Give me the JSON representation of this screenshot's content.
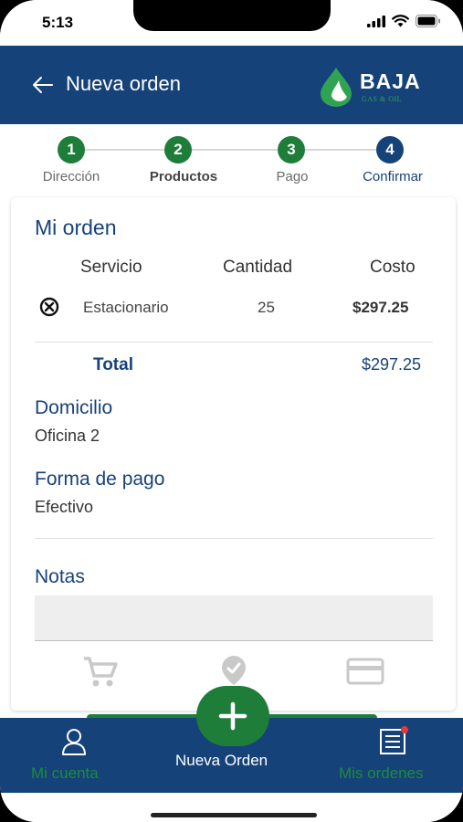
{
  "status_bar": {
    "time": "5:13"
  },
  "header": {
    "title": "Nueva orden",
    "logo_text": "BAJA",
    "logo_sub": "GAS & OIL"
  },
  "stepper": {
    "steps": [
      {
        "number": "1",
        "label": "Dirección",
        "state": "done",
        "color": "#1f7d3a"
      },
      {
        "number": "2",
        "label": "Productos",
        "state": "done",
        "color": "#1f7d3a"
      },
      {
        "number": "3",
        "label": "Pago",
        "state": "done",
        "color": "#1f7d3a"
      },
      {
        "number": "4",
        "label": "Confirmar",
        "state": "active",
        "color": "#16427a"
      }
    ]
  },
  "order": {
    "title": "Mi orden",
    "columns": {
      "service": "Servicio",
      "quantity": "Cantidad",
      "cost": "Costo"
    },
    "items": [
      {
        "service": "Estacionario",
        "quantity": "25",
        "cost": "$297.25"
      }
    ],
    "total_label": "Total",
    "total_value": "$297.25"
  },
  "address": {
    "label": "Domicilio",
    "value": "Oficina 2"
  },
  "payment": {
    "label": "Forma de pago",
    "value": "Efectivo"
  },
  "notes": {
    "label": "Notas",
    "value": ""
  },
  "card_icons": [
    "cart-icon",
    "location-pin-icon",
    "credit-card-icon"
  ],
  "bottom_nav": {
    "account": "Mi cuenta",
    "new_order": "Nueva Orden",
    "my_orders": "Mis ordenes"
  },
  "colors": {
    "primary_blue": "#16427a",
    "primary_green": "#1f7d3a"
  }
}
